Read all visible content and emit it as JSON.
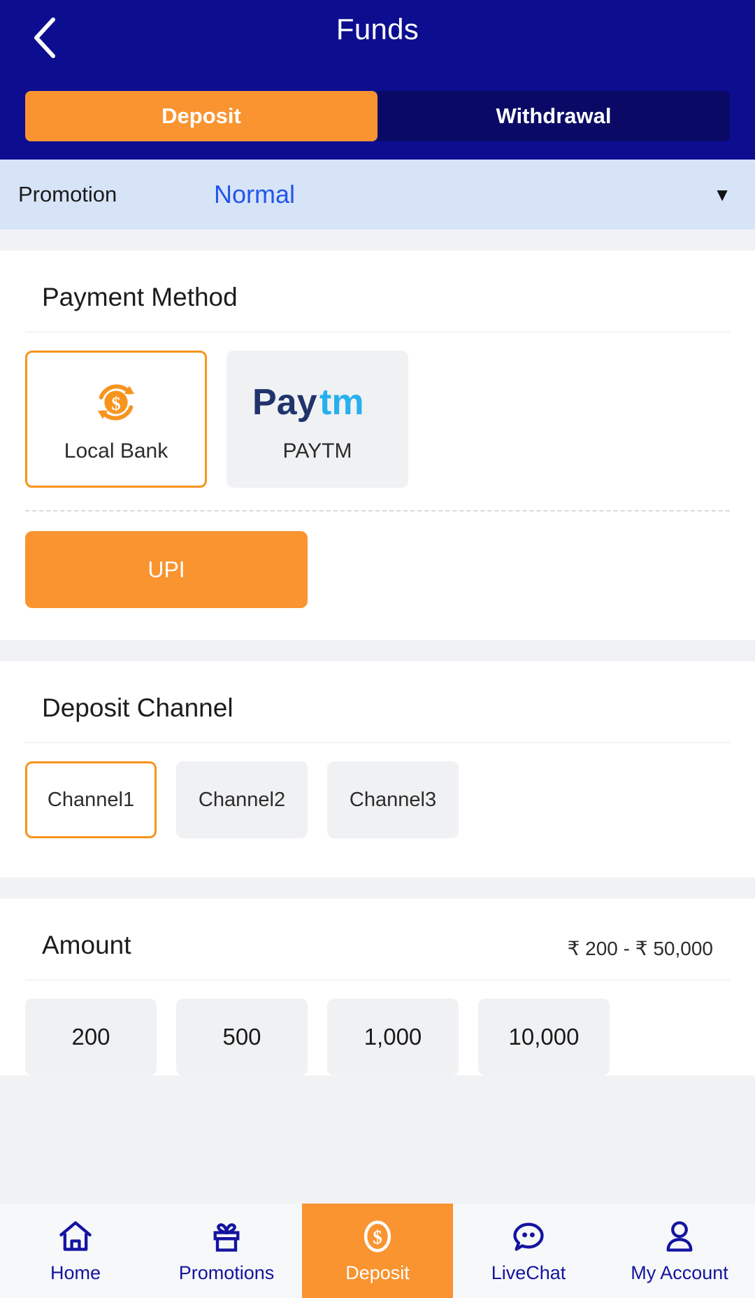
{
  "header": {
    "title": "Funds",
    "back_icon": "chevron-left-icon",
    "tabs": [
      {
        "label": "Deposit",
        "active": true
      },
      {
        "label": "Withdrawal",
        "active": false
      }
    ]
  },
  "promotion": {
    "label": "Promotion",
    "value": "Normal",
    "caret_icon": "chevron-down-icon",
    "value_color": "#2255ee",
    "bar_color": "#d7e4f7"
  },
  "payment_method": {
    "title": "Payment Method",
    "options": [
      {
        "label": "Local Bank",
        "icon": "refresh-dollar-coin-icon",
        "selected": true
      },
      {
        "label": "PAYTM",
        "icon": "paytm-logo-icon",
        "selected": false
      }
    ],
    "upi_button": "UPI"
  },
  "deposit_channel": {
    "title": "Deposit Channel",
    "channels": [
      {
        "label": "Channel1",
        "selected": true
      },
      {
        "label": "Channel2",
        "selected": false
      },
      {
        "label": "Channel3",
        "selected": false
      }
    ]
  },
  "amount": {
    "title": "Amount",
    "range": "₹ 200 - ₹ 50,000",
    "presets": [
      "200",
      "500",
      "1,000",
      "10,000"
    ]
  },
  "bottom_nav": [
    {
      "label": "Home",
      "icon": "home-icon",
      "active": false
    },
    {
      "label": "Promotions",
      "icon": "gift-icon",
      "active": false
    },
    {
      "label": "Deposit",
      "icon": "dollar-coin-icon",
      "active": true
    },
    {
      "label": "LiveChat",
      "icon": "chat-bubble-icon",
      "active": false
    },
    {
      "label": "My Account",
      "icon": "user-icon",
      "active": false
    }
  ],
  "colors": {
    "brand_navy": "#0d0d8f",
    "accent_orange": "#f99430",
    "tab_inactive": "#0a0a66",
    "page_bg": "#f1f2f4"
  }
}
